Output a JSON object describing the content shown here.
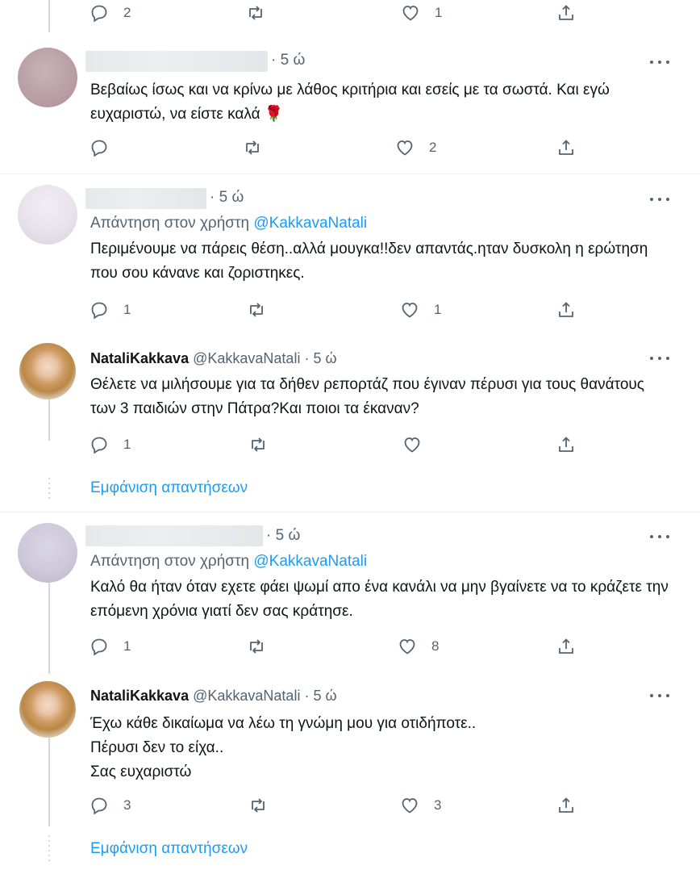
{
  "tweets": [
    {
      "time": "· 5 ώ",
      "text": "Βεβαίως ίσως και να κρίνω με λάθος κριτήρια και εσείς με τα σωστά. Και εγώ ευχαριστώ, να είστε καλά 🌹",
      "replies": "",
      "likes": "2"
    },
    {
      "time": "· 5 ώ",
      "reply_prefix": "Απάντηση στον χρήστη",
      "reply_mention": "@KakkavaNatali",
      "text": "Περιμένουμε να πάρεις θέση..αλλά μουγκα!!δεν απαντάς.ηταν δυσκολη η ερώτηση που σου κάνανε και ζοριστηκες.",
      "replies": "1",
      "likes": "1"
    },
    {
      "name": "NataliKakkava",
      "handle": "@KakkavaNatali",
      "time": "· 5 ώ",
      "text": "Θέλετε να μιλήσουμε για τα δήθεν ρεπορτάζ που έγιναν πέρυσι για τους θανάτους των 3 παιδιών στην Πάτρα?Και ποιοι τα έκαναν?",
      "replies": "1",
      "likes": ""
    },
    {
      "time": "· 5 ώ",
      "reply_prefix": "Απάντηση στον χρήστη",
      "reply_mention": "@KakkavaNatali",
      "text": "Καλό θα ήταν όταν εχετε φάει ψωμί απο ένα κανάλι να μην βγαίνετε να το κράζετε την επόμενη χρόνια γιατί δεν σας κράτησε.",
      "replies": "1",
      "likes": "8"
    },
    {
      "name": "NataliKakkava",
      "handle": "@KakkavaNatali",
      "time": "· 5 ώ",
      "text_lines": [
        "Έχω κάθε δικαίωμα να λέω τη γνώμη μου για οτιδήποτε..",
        "Πέρυσι δεν το είχα..",
        "Σας ευχαριστώ"
      ],
      "replies": "3",
      "likes": "3"
    }
  ],
  "top_bar": {
    "replies": "2",
    "likes": "1"
  },
  "show_replies_label": "Εμφάνιση απαντήσεων",
  "colors": {
    "accent": "#1d9bf0",
    "muted": "#536471",
    "text": "#0f1419"
  }
}
